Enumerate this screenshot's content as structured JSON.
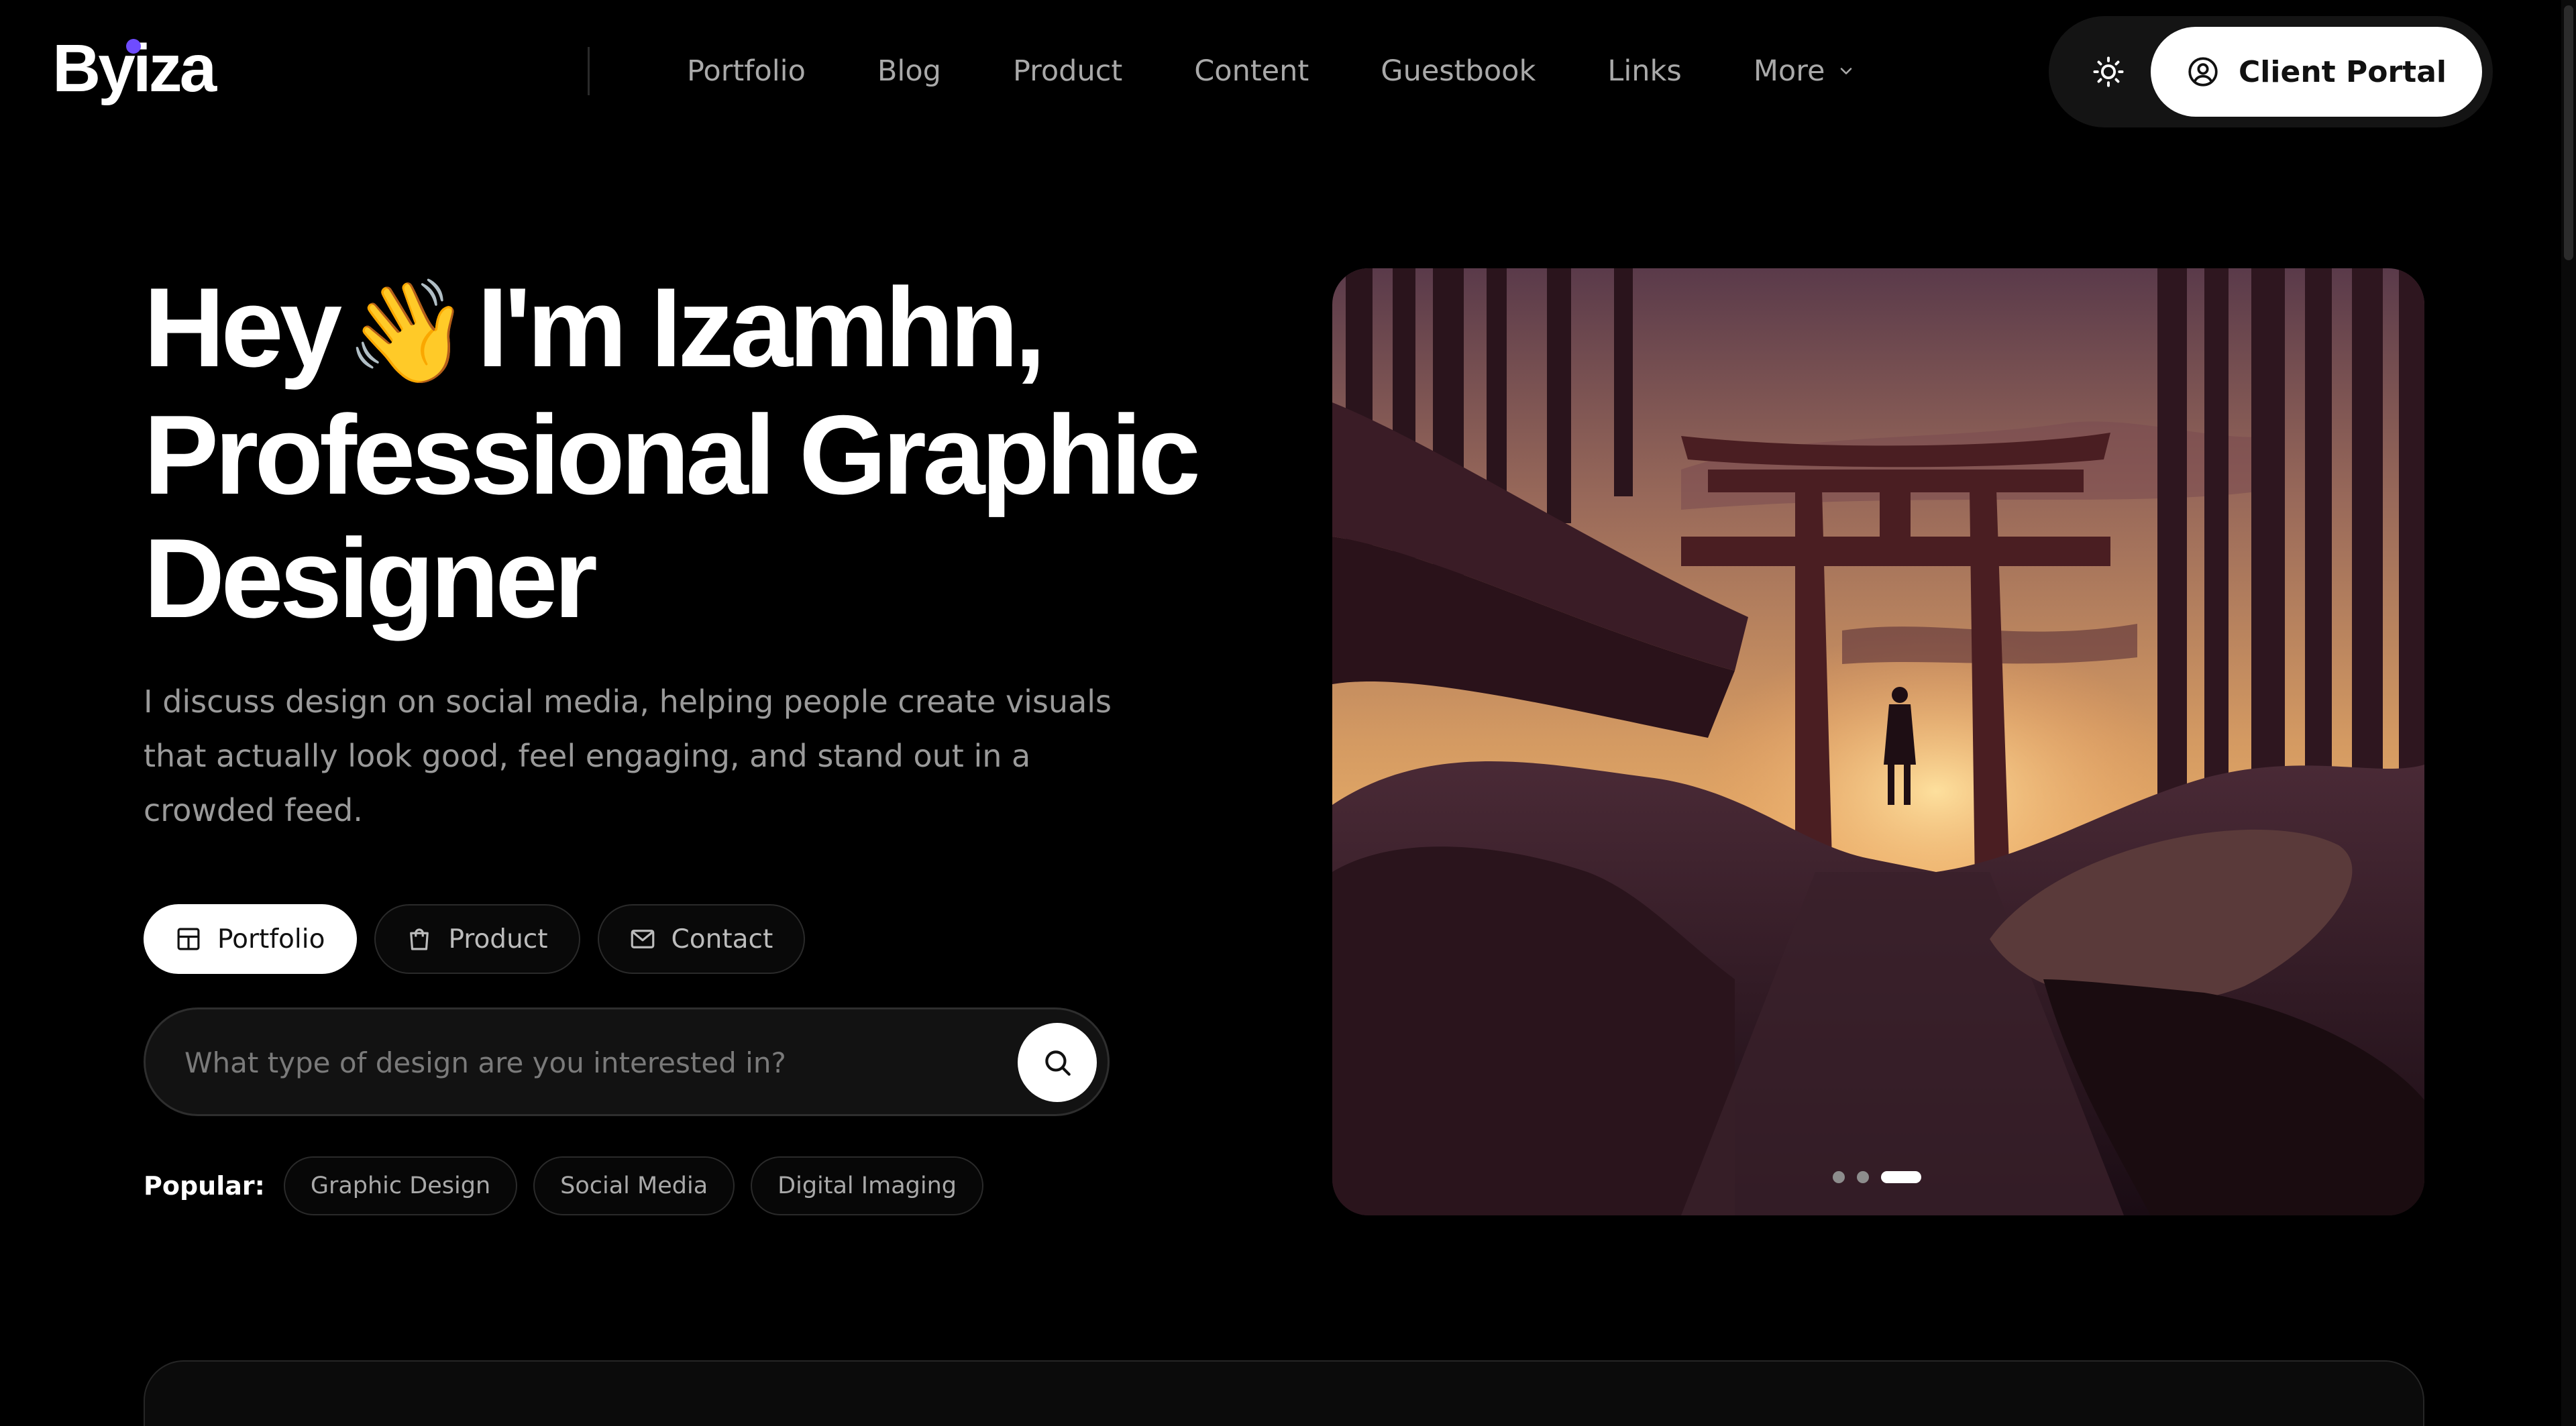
{
  "header": {
    "logo_text": "Byiza",
    "nav": [
      {
        "label": "Portfolio"
      },
      {
        "label": "Blog"
      },
      {
        "label": "Product"
      },
      {
        "label": "Content"
      },
      {
        "label": "Guestbook"
      },
      {
        "label": "Links"
      },
      {
        "label": "More"
      }
    ],
    "client_portal_label": "Client Portal",
    "accent_color": "#6f4cff"
  },
  "hero": {
    "title_line1_a": "Hey",
    "wave_emoji": "👋",
    "title_line1_b": "I'm Izamhn,",
    "title_line2": "Professional Graphic",
    "title_line3": "Designer",
    "subtitle": "I discuss design on social media, helping people create visuals that actually look good, feel engaging, and stand out in a crowded feed.",
    "buttons": [
      {
        "label": "Portfolio",
        "icon": "layout-grid-icon"
      },
      {
        "label": "Product",
        "icon": "shopping-bag-icon"
      },
      {
        "label": "Contact",
        "icon": "mail-icon"
      }
    ],
    "search": {
      "placeholder": "What type of design are you interested in?",
      "value": ""
    },
    "popular_label": "Popular:",
    "popular_tags": [
      "Graphic Design",
      "Social Media",
      "Digital Imaging"
    ],
    "carousel": {
      "slides": 3,
      "active": 3
    }
  }
}
